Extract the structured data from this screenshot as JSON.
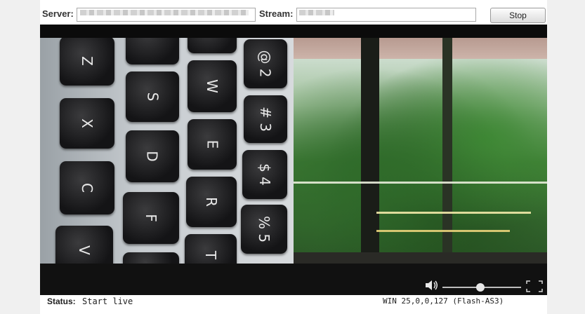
{
  "header": {
    "server_label": "Server:",
    "server_value": "",
    "stream_label": "Stream:",
    "stream_value": "",
    "stop_label": "Stop"
  },
  "video": {
    "keys": [
      "@ 2",
      "# 3",
      "$ 4",
      "% 5",
      "Z",
      "X",
      "C",
      "V",
      "S",
      "D",
      "F",
      "W",
      "E",
      "R",
      "T"
    ]
  },
  "player_controls": {
    "volume_icon": "speaker-icon",
    "volume_level": 0.48,
    "fullscreen_icon": "fullscreen-icon"
  },
  "status": {
    "label": "Status:",
    "value": "Start live",
    "version": "WIN 25,0,0,127 (Flash-AS3)"
  },
  "colors": {
    "player_bg": "#0b0b0b",
    "page_bg": "#ffffff",
    "outer_bg": "#f0f0f0"
  }
}
